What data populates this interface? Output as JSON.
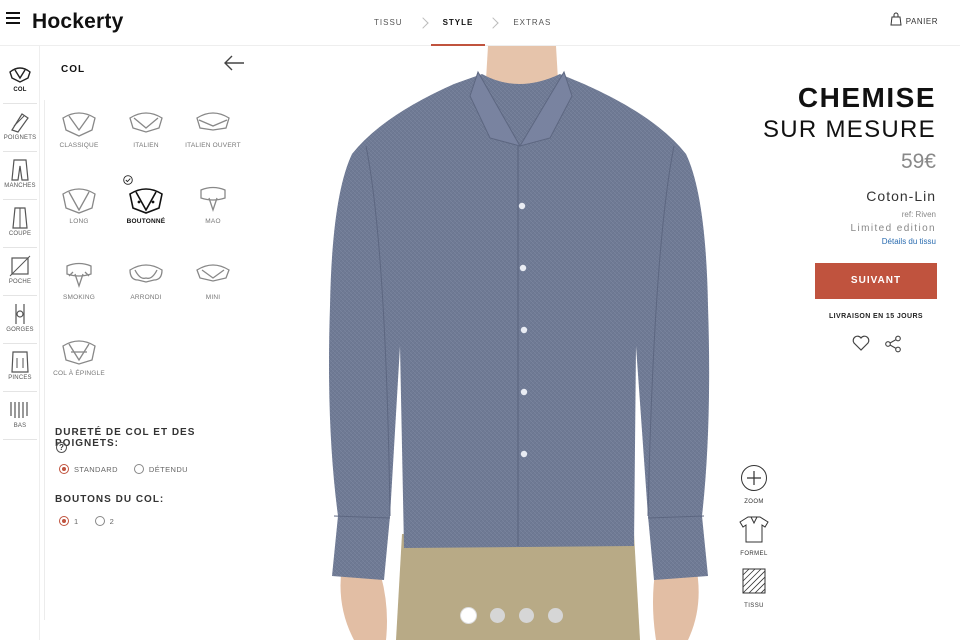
{
  "header": {
    "logo": "Hockerty",
    "steps": [
      {
        "label": "TISSU",
        "active": false
      },
      {
        "label": "STYLE",
        "active": true
      },
      {
        "label": "EXTRAS",
        "active": false
      }
    ],
    "cart_label": "PANIER"
  },
  "rail": {
    "items": [
      {
        "label": "COL",
        "active": true,
        "icon": "collar-icon"
      },
      {
        "label": "POIGNETS",
        "active": false,
        "icon": "cuff-icon"
      },
      {
        "label": "MANCHES",
        "active": false,
        "icon": "sleeve-icon"
      },
      {
        "label": "COUPE",
        "active": false,
        "icon": "fit-icon"
      },
      {
        "label": "POCHE",
        "active": false,
        "icon": "pocket-icon"
      },
      {
        "label": "GORGES",
        "active": false,
        "icon": "placket-icon"
      },
      {
        "label": "PINCES",
        "active": false,
        "icon": "darts-icon"
      },
      {
        "label": "BAS",
        "active": false,
        "icon": "hem-icon"
      }
    ]
  },
  "panel": {
    "title": "COL",
    "collars": [
      {
        "label": "CLASSIQUE",
        "selected": false
      },
      {
        "label": "ITALIEN",
        "selected": false
      },
      {
        "label": "ITALIEN OUVERT",
        "selected": false
      },
      {
        "label": "LONG",
        "selected": false
      },
      {
        "label": "BOUTONNÉ",
        "selected": true
      },
      {
        "label": "MAO",
        "selected": false
      },
      {
        "label": "SMOKING",
        "selected": false
      },
      {
        "label": "ARRONDI",
        "selected": false
      },
      {
        "label": "MINI",
        "selected": false
      },
      {
        "label": "COL À ÉPINGLE",
        "selected": false
      }
    ],
    "stiffness": {
      "title": "DURETÉ DE COL ET DES POIGNETS:",
      "help": "?",
      "options": [
        {
          "label": "STANDARD",
          "selected": true
        },
        {
          "label": "DÉTENDU",
          "selected": false
        }
      ]
    },
    "buttons": {
      "title": "BOUTONS DU COL:",
      "options": [
        {
          "label": "1",
          "selected": true
        },
        {
          "label": "2",
          "selected": false
        }
      ]
    }
  },
  "stage": {
    "tools": [
      {
        "label": "ZOOM",
        "icon": "zoom-icon"
      },
      {
        "label": "FORMEL",
        "icon": "shirt-formal-icon"
      },
      {
        "label": "TISSU",
        "icon": "fabric-icon"
      }
    ],
    "carousel_dots": 4,
    "active_dot": 1
  },
  "product": {
    "title_line1": "CHEMISE",
    "title_line2": "SUR MESURE",
    "price": "59€",
    "fabric": "Coton-Lin",
    "ref": "ref: Riven",
    "edition": "Limited edition",
    "details_link": "Détails du tissu",
    "cta": "SUIVANT",
    "delivery": "LIVRAISON EN 15 JOURS"
  },
  "colors": {
    "accent": "#c0533e",
    "shirt": "#6f7a94",
    "pants": "#b8aa86",
    "link": "#2a6cb0"
  }
}
